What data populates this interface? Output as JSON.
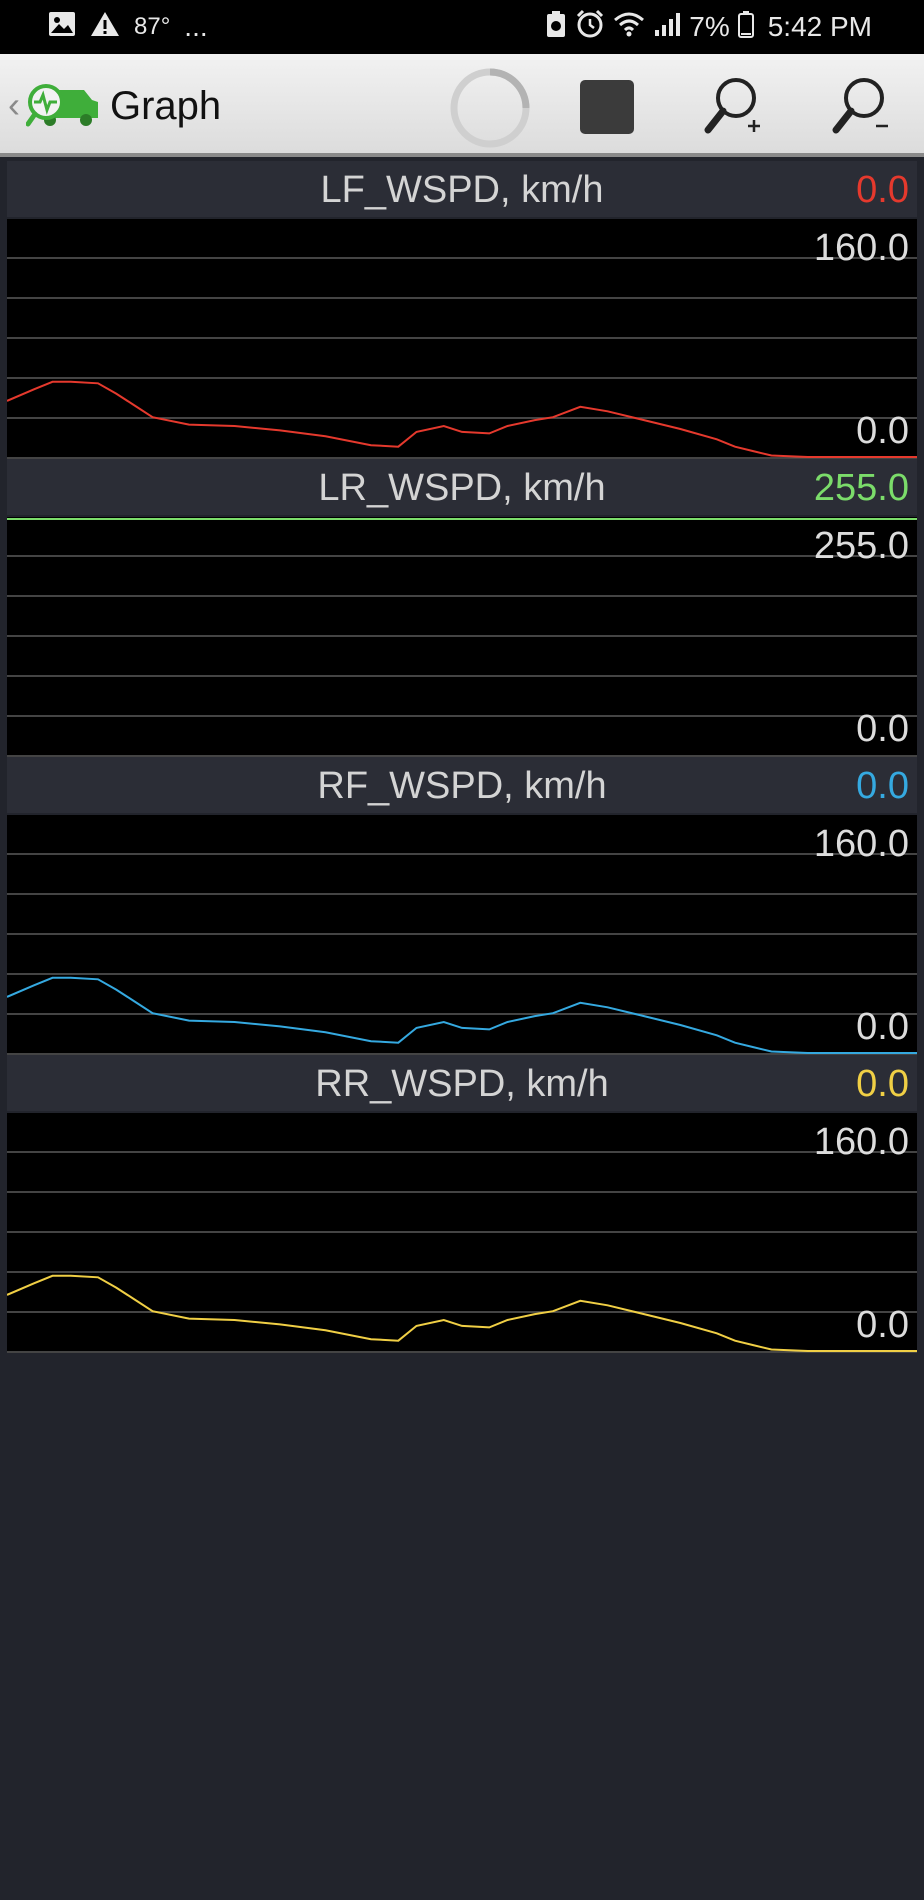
{
  "status_bar": {
    "temperature": "87°",
    "ellipsis": "...",
    "battery": "7%",
    "time": "5:42 PM"
  },
  "app_bar": {
    "title": "Graph",
    "icons": [
      "back-chevron-icon",
      "car-scan-logo-icon",
      "loading-spinner-icon",
      "stop-icon",
      "zoom-in-icon",
      "zoom-out-icon"
    ]
  },
  "chart_data": [
    {
      "type": "line",
      "title": "LF_WSPD, km/h",
      "current_value": "0.0",
      "color": "#e5392d",
      "ymax_label": "160.0",
      "ymin_label": "0.0",
      "ylim": [
        0,
        160
      ],
      "series": [
        {
          "x": [
            0,
            3,
            5,
            7,
            10,
            12,
            14,
            16,
            20,
            25,
            30,
            35,
            40,
            43,
            45,
            48,
            50,
            53,
            55,
            58,
            60,
            63,
            66,
            70,
            74,
            78,
            80,
            82,
            84,
            88,
            92,
            96,
            100
          ],
          "values": [
            38,
            46,
            51,
            51,
            50,
            43,
            35,
            27,
            22,
            21,
            18,
            14,
            8,
            7,
            17,
            21,
            17,
            16,
            21,
            25,
            27,
            34,
            31,
            25,
            19,
            12,
            7,
            4,
            1,
            0,
            0,
            0,
            0
          ]
        }
      ]
    },
    {
      "type": "line",
      "title": "LR_WSPD, km/h",
      "current_value": "255.0",
      "color": "#7bdc6a",
      "ymax_label": "255.0",
      "ymin_label": "0.0",
      "ylim": [
        0,
        255
      ],
      "series": [
        {
          "x": [
            0,
            100
          ],
          "values": [
            255,
            255
          ]
        }
      ]
    },
    {
      "type": "line",
      "title": "RF_WSPD, km/h",
      "current_value": "0.0",
      "color": "#35a9e0",
      "ymax_label": "160.0",
      "ymin_label": "0.0",
      "ylim": [
        0,
        160
      ],
      "series": [
        {
          "x": [
            0,
            3,
            5,
            7,
            10,
            12,
            14,
            16,
            20,
            25,
            30,
            35,
            40,
            43,
            45,
            48,
            50,
            53,
            55,
            58,
            60,
            63,
            66,
            70,
            74,
            78,
            80,
            82,
            84,
            88,
            92,
            96,
            100
          ],
          "values": [
            38,
            46,
            51,
            51,
            50,
            43,
            35,
            27,
            22,
            21,
            18,
            14,
            8,
            7,
            17,
            21,
            17,
            16,
            21,
            25,
            27,
            34,
            31,
            25,
            19,
            12,
            7,
            4,
            1,
            0,
            0,
            0,
            0
          ]
        }
      ]
    },
    {
      "type": "line",
      "title": "RR_WSPD, km/h",
      "current_value": "0.0",
      "color": "#f0cf45",
      "ymax_label": "160.0",
      "ymin_label": "0.0",
      "ylim": [
        0,
        160
      ],
      "series": [
        {
          "x": [
            0,
            3,
            5,
            7,
            10,
            12,
            14,
            16,
            20,
            25,
            30,
            35,
            40,
            43,
            45,
            48,
            50,
            53,
            55,
            58,
            60,
            63,
            66,
            70,
            74,
            78,
            80,
            82,
            84,
            88,
            92,
            96,
            100
          ],
          "values": [
            38,
            46,
            51,
            51,
            50,
            43,
            35,
            27,
            22,
            21,
            18,
            14,
            8,
            7,
            17,
            21,
            17,
            16,
            21,
            25,
            27,
            34,
            31,
            25,
            19,
            12,
            7,
            4,
            1,
            0,
            0,
            0,
            0
          ]
        }
      ]
    }
  ]
}
